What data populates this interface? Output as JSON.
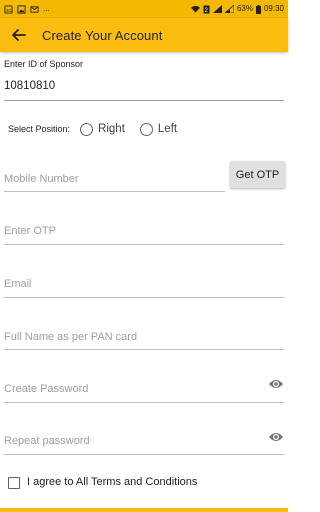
{
  "status_bar": {
    "left_icons": [
      "sim-icon",
      "image-icon",
      "message-icon"
    ],
    "dots": "...",
    "battery_percent": "63%",
    "time": "09:30"
  },
  "app_bar": {
    "title": "Create Your Account",
    "back_icon": "arrow-left-icon",
    "background": "#fdbd10"
  },
  "sponsor": {
    "label": "Enter ID of Sponsor",
    "value": "10810810"
  },
  "position": {
    "label": "Select Position:",
    "options": [
      "Right",
      "Left"
    ],
    "selected": ""
  },
  "form": {
    "mobile_placeholder": "Mobile Number",
    "get_otp_label": "Get OTP",
    "otp_placeholder": "Enter OTP",
    "email_placeholder": "Email",
    "full_name_placeholder": "Full Name as per PAN card",
    "create_password_placeholder": "Create Password",
    "repeat_password_placeholder": "Repeat password"
  },
  "terms": {
    "label": "I agree to All Terms and Conditions",
    "checked": false
  }
}
